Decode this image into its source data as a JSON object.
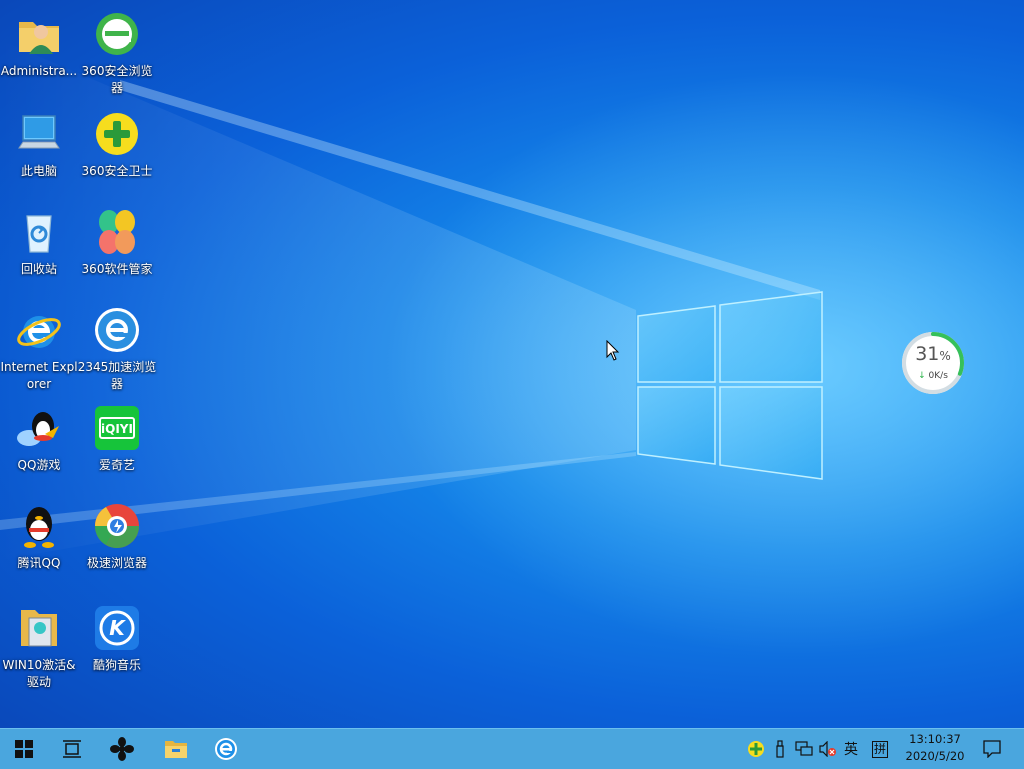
{
  "desktop": {
    "icons": [
      {
        "label": "Administra...",
        "icon": "user-folder-icon"
      },
      {
        "label": "360安全浏览器",
        "icon": "360-browser-icon"
      },
      {
        "label": "此电脑",
        "icon": "computer-icon"
      },
      {
        "label": "360安全卫士",
        "icon": "360-safeguard-icon"
      },
      {
        "label": "回收站",
        "icon": "recycle-bin-icon"
      },
      {
        "label": "360软件管家",
        "icon": "360-software-manager-icon"
      },
      {
        "label": "Internet Explorer",
        "icon": "internet-explorer-icon"
      },
      {
        "label": "2345加速浏览器",
        "icon": "2345-browser-icon"
      },
      {
        "label": "QQ游戏",
        "icon": "qq-game-icon"
      },
      {
        "label": "爱奇艺",
        "icon": "iqiyi-icon"
      },
      {
        "label": "腾讯QQ",
        "icon": "tencent-qq-icon"
      },
      {
        "label": "极速浏览器",
        "icon": "speed-browser-icon"
      },
      {
        "label": "WIN10激活&驱动",
        "icon": "activation-folder-icon"
      },
      {
        "label": "酷狗音乐",
        "icon": "kugou-music-icon"
      }
    ]
  },
  "speed_widget": {
    "percent": "31",
    "percent_sign": "%",
    "net_speed": "0K/s",
    "arrow": "↓",
    "usage": 0.31
  },
  "taskbar": {
    "buttons": [
      "start-icon",
      "task-view-icon",
      "fan-app-icon",
      "file-explorer-icon",
      "ie-taskbar-icon"
    ],
    "tray": {
      "ime_lang": "英",
      "ime_mode": "拼",
      "time": "13:10:37",
      "date": "2020/5/20"
    }
  },
  "colors": {
    "taskbar": "#4aa6de",
    "desktop_accent": "#1588ea"
  }
}
